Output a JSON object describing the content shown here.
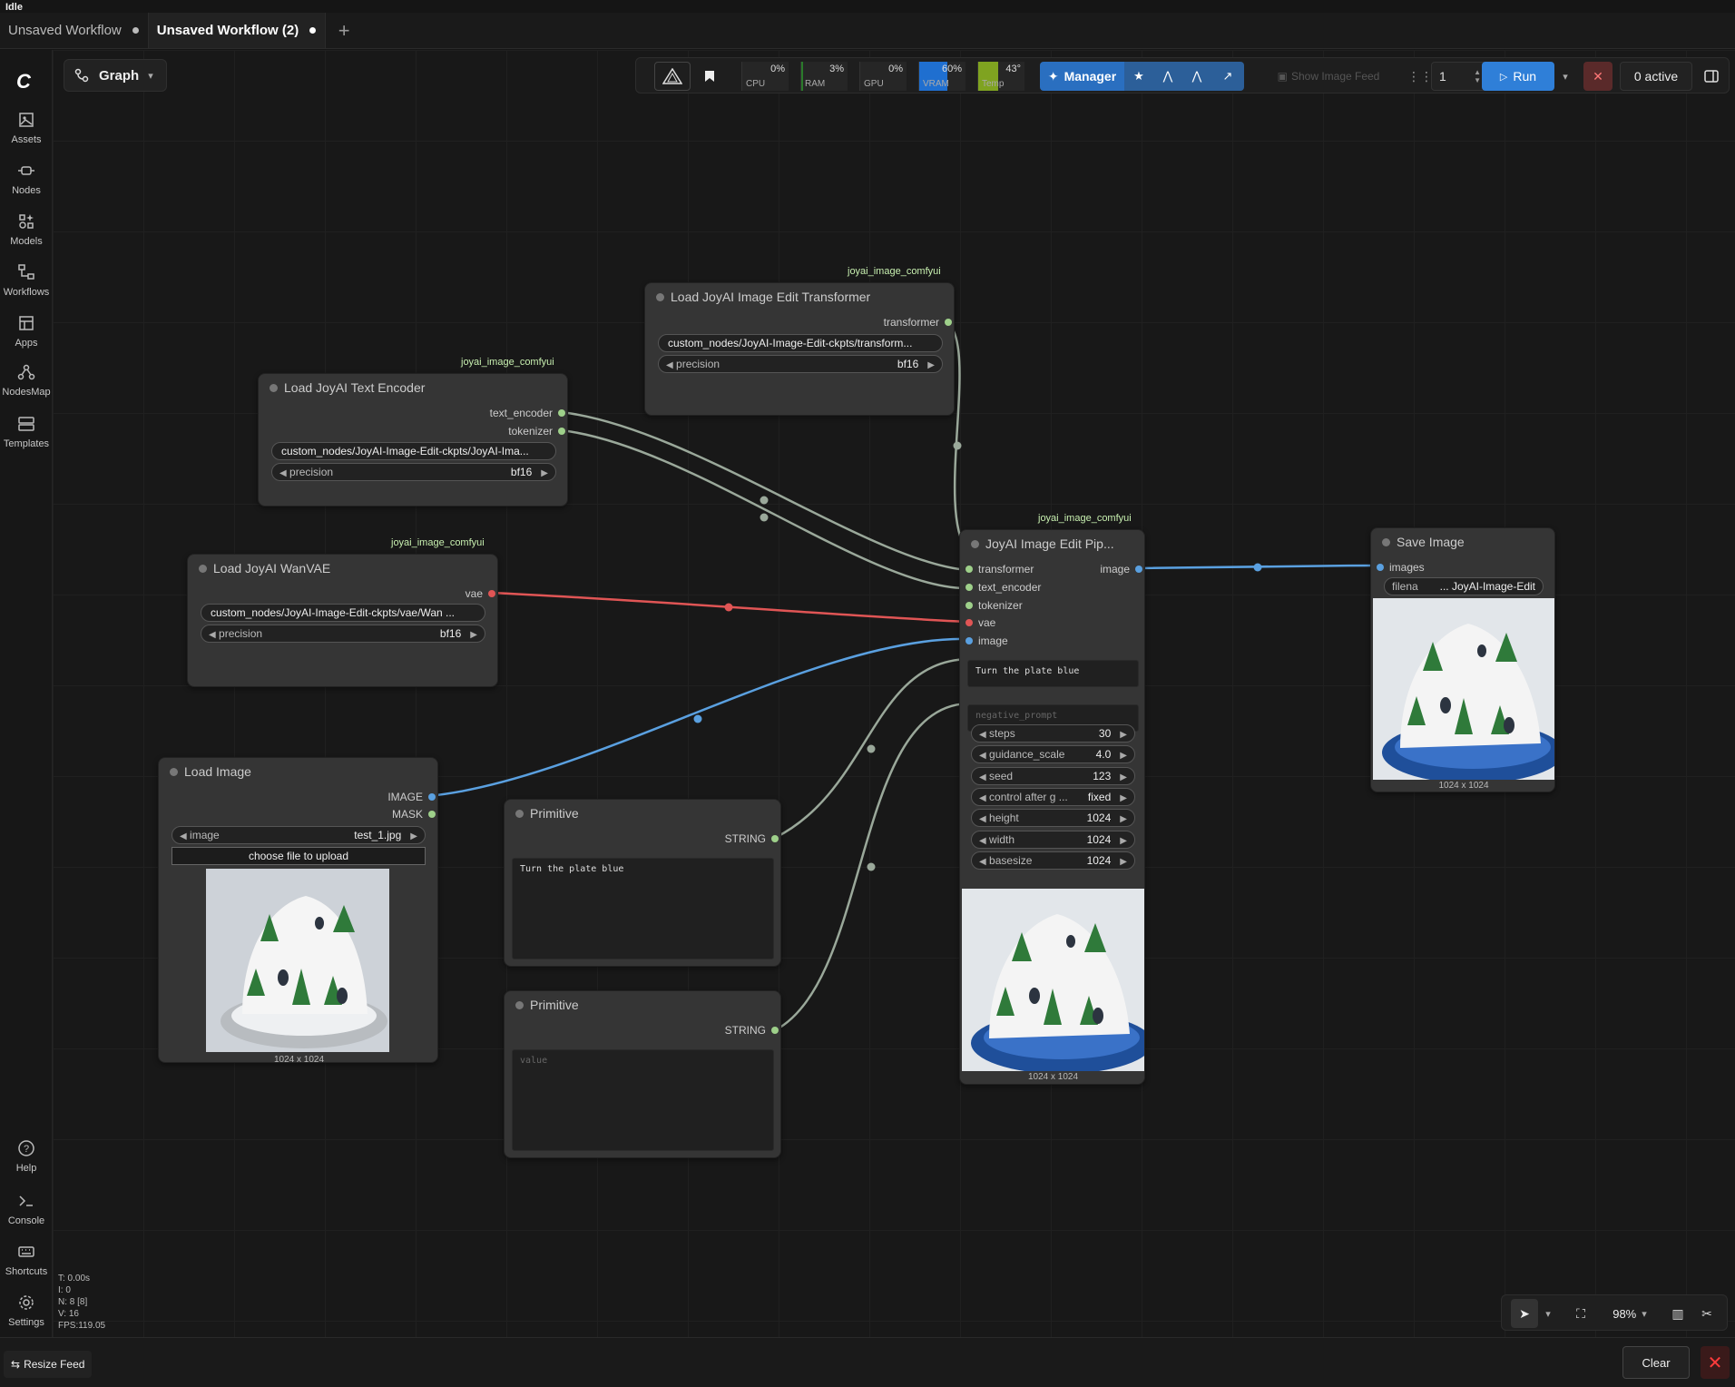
{
  "status": "Idle",
  "tabs": [
    {
      "label": "Unsaved Workflow"
    },
    {
      "label": "Unsaved Workflow (2)"
    }
  ],
  "sidebar": {
    "items": [
      {
        "label": "Assets",
        "icon": "image-icon"
      },
      {
        "label": "Nodes",
        "icon": "node-icon"
      },
      {
        "label": "Models",
        "icon": "models-icon"
      },
      {
        "label": "Workflows",
        "icon": "workflow-icon"
      },
      {
        "label": "Apps",
        "icon": "apps-icon"
      },
      {
        "label": "NodesMap",
        "icon": "nodesmap-icon"
      },
      {
        "label": "Templates",
        "icon": "templates-icon"
      }
    ],
    "bottom_items": [
      {
        "label": "Help",
        "icon": "help-icon"
      },
      {
        "label": "Console",
        "icon": "console-icon"
      },
      {
        "label": "Shortcuts",
        "icon": "keyboard-icon"
      },
      {
        "label": "Settings",
        "icon": "gear-icon"
      }
    ]
  },
  "graph_toggle": {
    "label": "Graph"
  },
  "toolbar": {
    "meters": [
      {
        "label": "CPU",
        "value": "0%",
        "level": 0,
        "color": "#2a7a2a"
      },
      {
        "label": "RAM",
        "value": "3%",
        "level": 0.03,
        "color": "#2a7a2a"
      },
      {
        "label": "GPU",
        "value": "0%",
        "level": 0,
        "color": "#2a7a2a"
      },
      {
        "label": "VRAM",
        "value": "60%",
        "level": 0.6,
        "color": "#1f6fd0"
      },
      {
        "label": "Temp",
        "value": "43°",
        "level": 0.43,
        "color": "#7fa320"
      }
    ],
    "manager_label": "Manager",
    "image_feed_label": "Show Image Feed",
    "queue_count": "1",
    "run_label": "Run",
    "active_label": "0 active"
  },
  "nodes": {
    "text_encoder": {
      "badge": "joyai_image_comfyui",
      "title": "Load JoyAI Text Encoder",
      "outputs": [
        "text_encoder",
        "tokenizer"
      ],
      "path": "custom_nodes/JoyAI-Image-Edit-ckpts/JoyAI-Ima...",
      "precision_label": "precision",
      "precision_value": "bf16"
    },
    "transformer": {
      "badge": "joyai_image_comfyui",
      "title": "Load JoyAI Image Edit Transformer",
      "outputs": [
        "transformer"
      ],
      "path": "custom_nodes/JoyAI-Image-Edit-ckpts/transform...",
      "precision_label": "precision",
      "precision_value": "bf16"
    },
    "vae": {
      "badge": "joyai_image_comfyui",
      "title": "Load JoyAI WanVAE",
      "outputs": [
        "vae"
      ],
      "path": "custom_nodes/JoyAI-Image-Edit-ckpts/vae/Wan ...",
      "precision_label": "precision",
      "precision_value": "bf16"
    },
    "load_image": {
      "title": "Load Image",
      "outputs": [
        "IMAGE",
        "MASK"
      ],
      "image_label": "image",
      "image_value": "test_1.jpg",
      "upload_label": "choose file to upload",
      "dims": "1024 x 1024"
    },
    "primitive1": {
      "title": "Primitive",
      "output": "STRING",
      "text": "Turn the plate blue"
    },
    "primitive2": {
      "title": "Primitive",
      "output": "STRING",
      "placeholder": "value"
    },
    "pipeline": {
      "badge": "joyai_image_comfyui",
      "title": "JoyAI Image Edit Pip...",
      "inputs": [
        "transformer",
        "text_encoder",
        "tokenizer",
        "vae",
        "image"
      ],
      "output": "image",
      "prompt": "Turn the plate blue",
      "negative_placeholder": "negative_prompt",
      "widgets": [
        {
          "label": "steps",
          "value": "30"
        },
        {
          "label": "guidance_scale",
          "value": "4.0"
        },
        {
          "label": "seed",
          "value": "123"
        },
        {
          "label": "control after g ...",
          "value": "fixed"
        },
        {
          "label": "height",
          "value": "1024"
        },
        {
          "label": "width",
          "value": "1024"
        },
        {
          "label": "basesize",
          "value": "1024"
        }
      ],
      "dims": "1024 x 1024"
    },
    "save_image": {
      "title": "Save Image",
      "input": "images",
      "filename_label": "filena",
      "filename_value": "... JoyAI-Image-Edit",
      "dims": "1024 x 1024"
    }
  },
  "stats": [
    "T: 0.00s",
    "I: 0",
    "N: 8 [8]",
    "V: 16",
    "FPS:119.05"
  ],
  "canvas_controls": {
    "zoom": "98%"
  },
  "bottom": {
    "resize_label": "Resize Feed",
    "clear_label": "Clear"
  },
  "colors": {
    "link_default": "#9aa89a",
    "link_vae": "#e05555",
    "link_image": "#5aa0e0",
    "accent": "#2f7fd8"
  }
}
